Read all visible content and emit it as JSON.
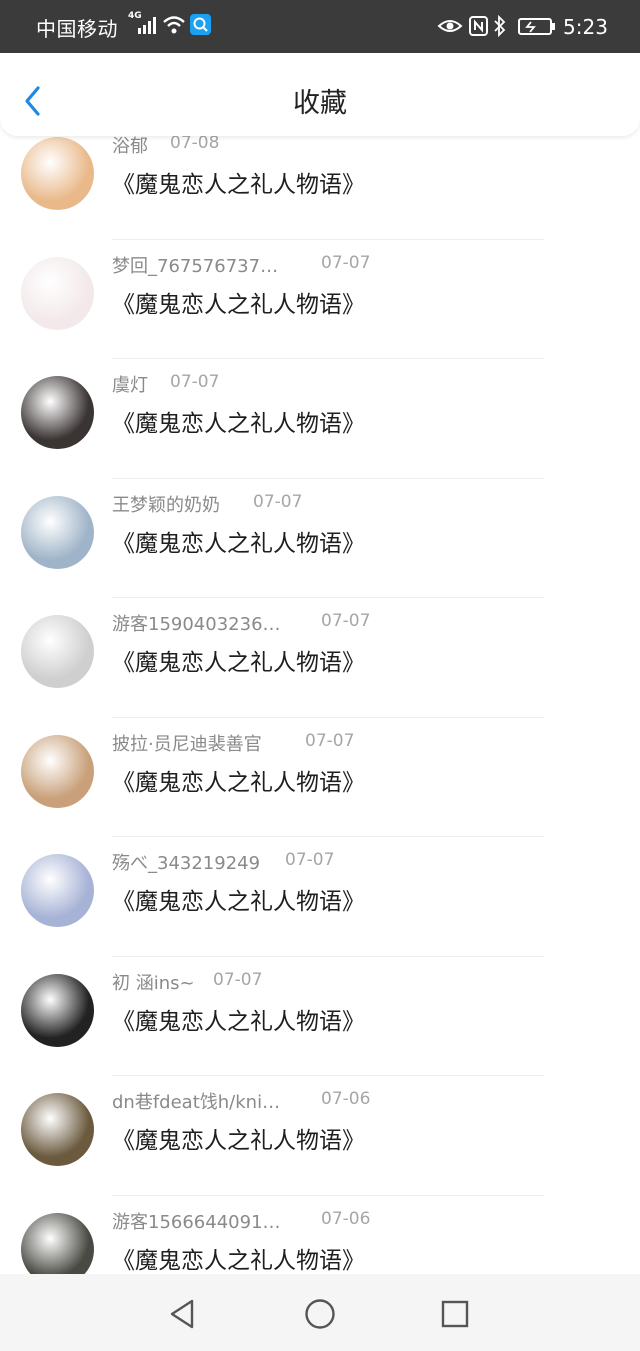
{
  "status_bar": {
    "carrier": "中国移动",
    "network": "4G",
    "time": "5:23"
  },
  "header": {
    "title": "收藏"
  },
  "items": [
    {
      "user": "浴郁",
      "date": "07-08",
      "title": "《魔鬼恋人之礼人物语》",
      "avatar": "#e9b98a"
    },
    {
      "user": "梦回_767576737…",
      "date": "07-07",
      "title": "《魔鬼恋人之礼人物语》",
      "avatar": "#f3e9ea"
    },
    {
      "user": "虞灯",
      "date": "07-07",
      "title": "《魔鬼恋人之礼人物语》",
      "avatar": "#3a3433"
    },
    {
      "user": "王梦颖的奶奶",
      "date": "07-07",
      "title": "《魔鬼恋人之礼人物语》",
      "avatar": "#9fb4c8"
    },
    {
      "user": "游客1590403236…",
      "date": "07-07",
      "title": "《魔鬼恋人之礼人物语》",
      "avatar": "#cfcfcf"
    },
    {
      "user": "披拉·员尼迪裴善官",
      "date": "07-07",
      "title": "《魔鬼恋人之礼人物语》",
      "avatar": "#c9a07a"
    },
    {
      "user": "殇べ_343219249",
      "date": "07-07",
      "title": "《魔鬼恋人之礼人物语》",
      "avatar": "#a7b3d6"
    },
    {
      "user": "初 涵ins~",
      "date": "07-07",
      "title": "《魔鬼恋人之礼人物语》",
      "avatar": "#222222"
    },
    {
      "user": "dn巷fdeat饯h/kni…",
      "date": "07-06",
      "title": "《魔鬼恋人之礼人物语》",
      "avatar": "#6b5a3e"
    },
    {
      "user": "游客1566644091…",
      "date": "07-06",
      "title": "《魔鬼恋人之礼人物语》",
      "avatar": "#4a4a44"
    }
  ],
  "colors": {
    "accent": "#1e88e5",
    "status_bar_bg": "#3b3b3b"
  }
}
